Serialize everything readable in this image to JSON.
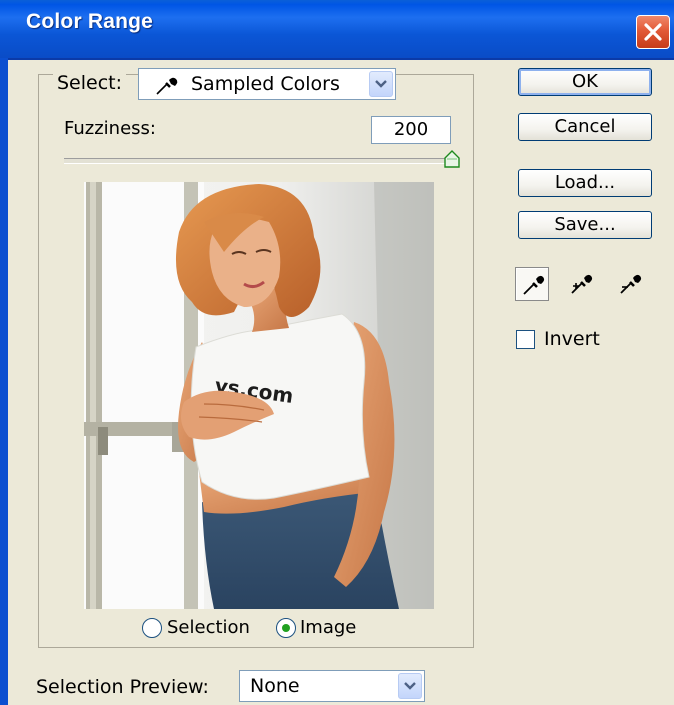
{
  "window": {
    "title": "Color Range",
    "close_icon": "close-icon"
  },
  "select": {
    "label": "Select:",
    "value": "Sampled Colors",
    "icon": "eyedropper-icon"
  },
  "fuzziness": {
    "label": "Fuzziness:",
    "value": "200",
    "slider_fraction": 1.0
  },
  "preview": {
    "image_description_icon": "preview-image",
    "shirt_text": "ys.com"
  },
  "view_mode": {
    "selection_label": "Selection",
    "image_label": "Image",
    "selected": "Image"
  },
  "buttons": {
    "ok": "OK",
    "cancel": "Cancel",
    "load": "Load...",
    "save": "Save..."
  },
  "eyedroppers": [
    {
      "name": "eyedropper-icon",
      "active": true
    },
    {
      "name": "eyedropper-plus-icon",
      "active": false
    },
    {
      "name": "eyedropper-minus-icon",
      "active": false
    }
  ],
  "invert": {
    "label": "Invert",
    "checked": false
  },
  "selection_preview": {
    "label": "Selection Preview:",
    "value": "None"
  },
  "colors": {
    "titlebar": "#0055e5",
    "dialog_bg": "#ece9d8",
    "close_button": "#e25a37",
    "button_border": "#003c74",
    "radio_dot": "#21a121"
  }
}
